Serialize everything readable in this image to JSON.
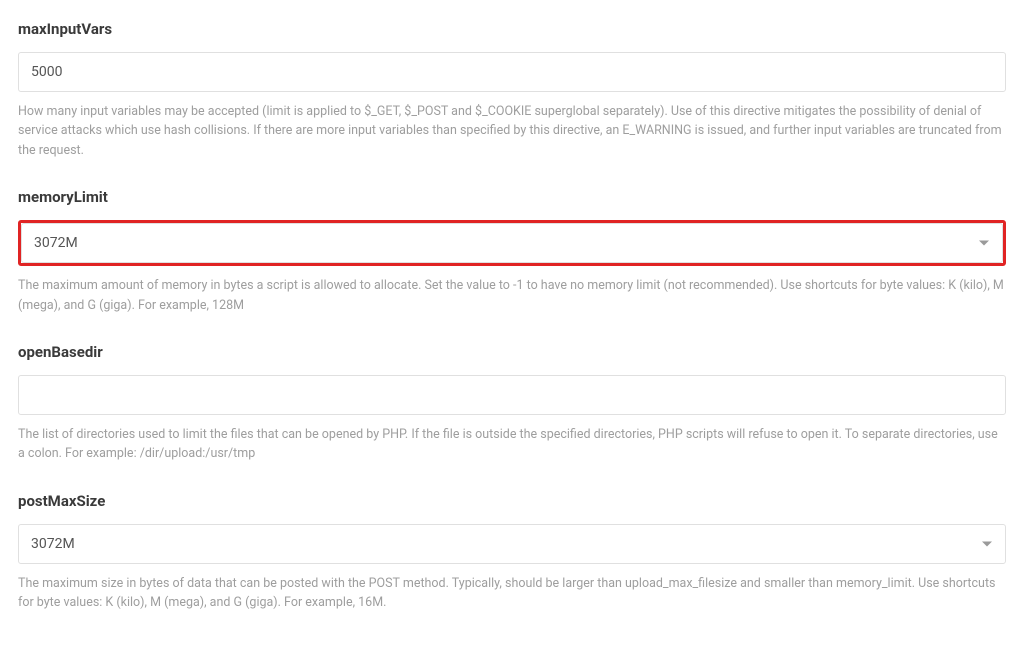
{
  "fields": {
    "maxInputVars": {
      "label": "maxInputVars",
      "value": "5000",
      "description": "How many input variables may be accepted (limit is applied to $_GET, $_POST and $_COOKIE superglobal separately). Use of this directive mitigates the possibility of denial of service attacks which use hash collisions. If there are more input variables than specified by this directive, an E_WARNING is issued, and further input variables are truncated from the request."
    },
    "memoryLimit": {
      "label": "memoryLimit",
      "value": "3072M",
      "description": "The maximum amount of memory in bytes a script is allowed to allocate. Set the value to -1 to have no memory limit (not recommended). Use shortcuts for byte values: K (kilo), M (mega), and G (giga). For example, 128M"
    },
    "openBasedir": {
      "label": "openBasedir",
      "value": "",
      "description": "The list of directories used to limit the files that can be opened by PHP. If the file is outside the specified directories, PHP scripts will refuse to open it. To separate directories, use a colon. For example: /dir/upload:/usr/tmp"
    },
    "postMaxSize": {
      "label": "postMaxSize",
      "value": "3072M",
      "description": "The maximum size in bytes of data that can be posted with the POST method. Typically, should be larger than upload_max_filesize and smaller than memory_limit. Use shortcuts for byte values: K (kilo), M (mega), and G (giga). For example, 16M."
    }
  }
}
